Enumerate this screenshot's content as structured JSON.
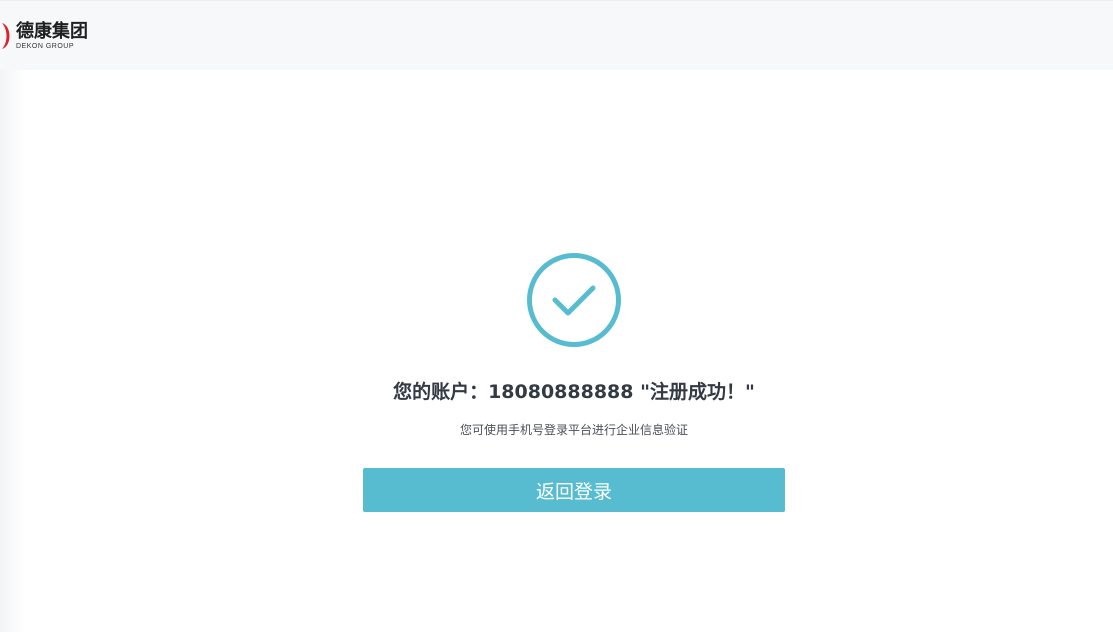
{
  "header": {
    "logo_name_cn": "德康集团",
    "logo_name_en": "DEKON GROUP"
  },
  "result": {
    "icon": "check-circle-icon",
    "title": "您的账户：18080888888 \"注册成功！\"",
    "subtitle": "您可使用手机号登录平台进行企业信息验证",
    "back_button_label": "返回登录"
  },
  "colors": {
    "accent": "#57bccf",
    "logo_red": "#d7262b",
    "header_bg": "#f7f8fa",
    "title_text": "#333a44"
  }
}
